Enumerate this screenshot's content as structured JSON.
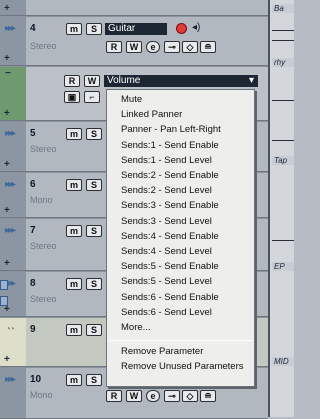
{
  "tracks": [
    {
      "num": "4",
      "name": "Guitar",
      "sub": "Stereo",
      "btn_m": "m",
      "btn_s": "S",
      "btn_r": "R",
      "btn_w": "W",
      "btn_e": "e"
    },
    {
      "num": "",
      "param": "Volume",
      "btn_r": "R",
      "btn_w": "W"
    },
    {
      "num": "5",
      "sub": "Stereo",
      "btn_m": "m",
      "btn_s": "S"
    },
    {
      "num": "6",
      "sub": "Mono",
      "btn_m": "m",
      "btn_s": "S"
    },
    {
      "num": "7",
      "sub": "Stereo",
      "btn_m": "m",
      "btn_s": "S"
    },
    {
      "num": "8",
      "sub": "Stereo",
      "btn_m": "m",
      "btn_s": "S"
    },
    {
      "num": "9",
      "btn_m": "m",
      "btn_s": "S"
    },
    {
      "num": "10",
      "sub": "Mono",
      "btn_m": "m",
      "btn_s": "S",
      "btn_r": "R",
      "btn_w": "W",
      "btn_e": "e"
    }
  ],
  "menu": {
    "items": [
      "Mute",
      "Linked Panner",
      "Panner - Pan Left-Right",
      "Sends:1 - Send Enable",
      "Sends:1 - Send Level",
      "Sends:2 - Send Enable",
      "Sends:2 - Send Level",
      "Sends:3 - Send Enable",
      "Sends:3 - Send Level",
      "Sends:4 - Send Enable",
      "Sends:4 - Send Level",
      "Sends:5 - Send Enable",
      "Sends:5 - Send Level",
      "Sends:6 - Send Enable",
      "Sends:6 - Send Level",
      "More..."
    ],
    "footer_items": [
      "Remove Parameter",
      "Remove Unused Parameters"
    ]
  },
  "right_labels": [
    "Ba",
    "rhy",
    "Tap",
    "EP",
    "MID"
  ],
  "colors": {
    "menu_bg": "#eeeeed",
    "param_field": "#1d2733",
    "record": "#e03a3a"
  }
}
